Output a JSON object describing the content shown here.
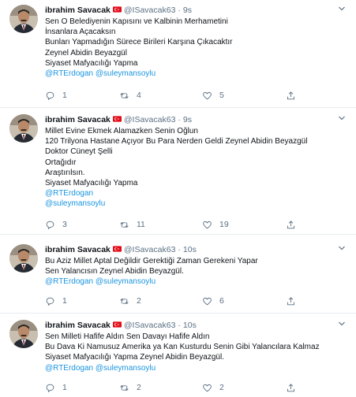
{
  "colors": {
    "link": "#1b95e0",
    "muted": "#5b7083",
    "divider": "#e6ecf0"
  },
  "tweets": [
    {
      "name": "ibrahim Savacak",
      "handle": "@ISavacak63",
      "separator": "·",
      "time": "9s",
      "lines": [
        {
          "text": "Sen O Belediyenin Kapısını ve Kalbinin Merhametini",
          "type": "text"
        },
        {
          "text": "İnsanlara Açacaksın",
          "type": "text"
        },
        {
          "text": "Bunları Yapmadığın Sürece Birileri Karşına Çıkacaktır",
          "type": "text"
        },
        {
          "text": "Zeynel Abidin Beyazgül",
          "type": "text"
        },
        {
          "text": "Siyaset Mafyacılığı Yapma",
          "type": "text"
        },
        {
          "text": "@RTErdogan @suleymansoylu",
          "type": "link"
        }
      ],
      "counts": {
        "reply": "1",
        "retweet": "4",
        "like": "5"
      }
    },
    {
      "name": "ibrahim Savacak",
      "handle": "@ISavacak63",
      "separator": "·",
      "time": "9s",
      "lines": [
        {
          "text": "Millet Evine Ekmek Alamazken Senin Oğlun",
          "type": "text"
        },
        {
          "text": "120 Trilyona Hastane Açıyor Bu Para Nerden Geldi Zeynel Abidin Beyazgül",
          "type": "text"
        },
        {
          "text": "Doktor Cüneyt Şelli",
          "type": "text"
        },
        {
          "text": "Ortağıdır",
          "type": "text"
        },
        {
          "text": "Araştırılsın.",
          "type": "text"
        },
        {
          "text": "Siyaset Mafyacılığı Yapma",
          "type": "text"
        },
        {
          "text": "@RTErdogan",
          "type": "link"
        },
        {
          "text": "@suleymansoylu",
          "type": "link"
        }
      ],
      "counts": {
        "reply": "3",
        "retweet": "11",
        "like": "19"
      }
    },
    {
      "name": "ibrahim Savacak",
      "handle": "@ISavacak63",
      "separator": "·",
      "time": "10s",
      "lines": [
        {
          "text": "Bu Aziz Millet Aptal Değildir Gerektiği Zaman Gerekeni Yapar",
          "type": "text"
        },
        {
          "text": "Sen Yalancısın Zeynel Abidin Beyazgül.",
          "type": "text"
        },
        {
          "text": "@RTErdogan @suleymansoylu",
          "type": "link"
        }
      ],
      "counts": {
        "reply": "1",
        "retweet": "2",
        "like": "6"
      }
    },
    {
      "name": "ibrahim Savacak",
      "handle": "@ISavacak63",
      "separator": "·",
      "time": "10s",
      "lines": [
        {
          "text": "Sen Milleti Hafife Aldın Sen Davayı Hafife Aldın",
          "type": "text"
        },
        {
          "text": "Bu Dava Ki Namusuz Amerika ya Kan Kusturdu Senin Gibi Yalancılara Kalmaz",
          "type": "text"
        },
        {
          "text": "Siyaset Mafyacılığı Yapma Zeynel Abidin Beyazgül.",
          "type": "text"
        },
        {
          "text": "@RTErdogan @suleymansoylu",
          "type": "link"
        }
      ],
      "counts": {
        "reply": "1",
        "retweet": "2",
        "like": "2"
      }
    }
  ]
}
